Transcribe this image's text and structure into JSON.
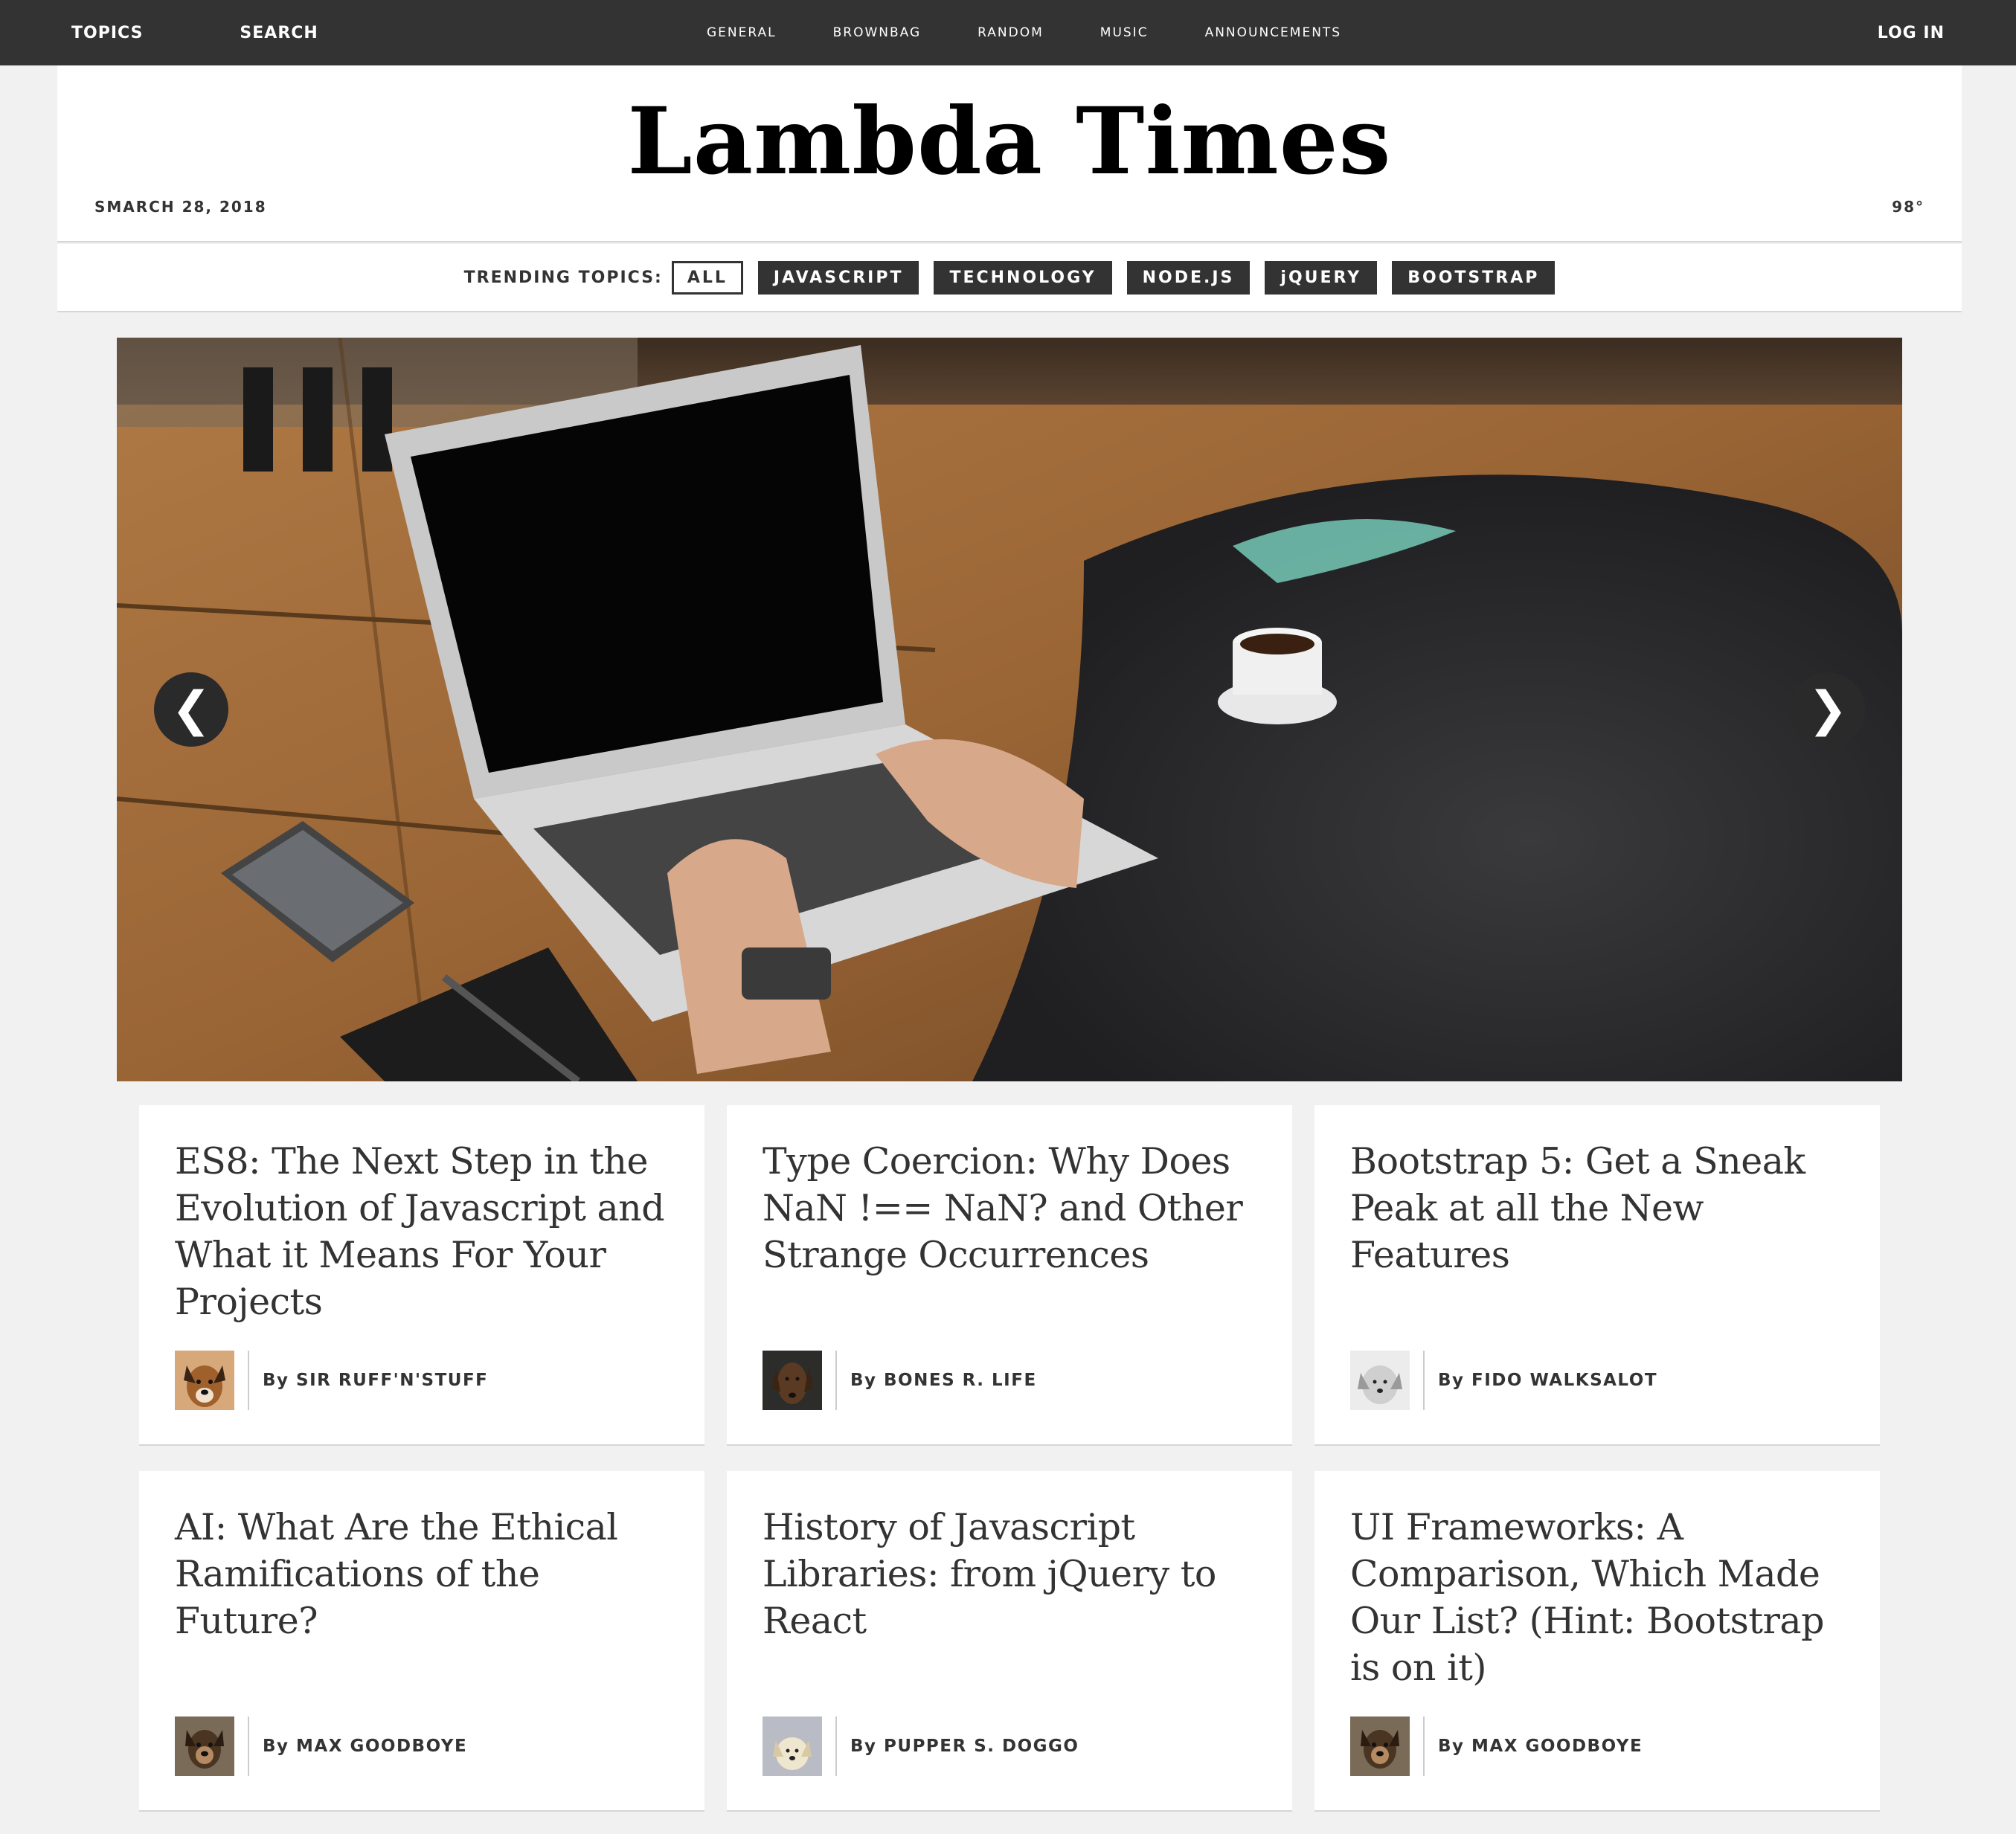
{
  "topbar": {
    "left_links": [
      "TOPICS",
      "SEARCH"
    ],
    "center_links": [
      "GENERAL",
      "BROWNBAG",
      "RANDOM",
      "MUSIC",
      "ANNOUNCEMENTS"
    ],
    "login": "LOG IN"
  },
  "header": {
    "title": "Lambda Times",
    "date": "SMARCH 28, 2018",
    "temperature": "98°"
  },
  "trending": {
    "label": "TRENDING TOPICS:",
    "tabs": [
      "ALL",
      "JAVASCRIPT",
      "TECHNOLOGY",
      "NODE.JS",
      "jQUERY",
      "BOOTSTRAP"
    ],
    "active_tab": "ALL"
  },
  "carousel": {
    "prev_arrow": "❮",
    "next_arrow": "❯"
  },
  "cards": [
    {
      "headline": "ES8: The Next Step in the Evolution of Javascript and What it Means For Your Projects",
      "byline": "By SIR RUFF'N'STUFF"
    },
    {
      "headline": "Type Coercion: Why Does NaN !== NaN? and Other Strange Occurrences",
      "byline": "By BONES R. LIFE"
    },
    {
      "headline": "Bootstrap 5: Get a Sneak Peak at all the New Features",
      "byline": "By FIDO WALKSALOT"
    },
    {
      "headline": "AI: What Are the Ethical Ramifications of the Future?",
      "byline": "By MAX GOODBOYE"
    },
    {
      "headline": "History of Javascript Libraries: from jQuery to React",
      "byline": "By PUPPER S. DOGGO"
    },
    {
      "headline": "UI Frameworks: A Comparison, Which Made Our List? (Hint: Bootstrap is on it)",
      "byline": "By MAX GOODBOYE"
    }
  ],
  "colors": {
    "topbar_bg": "#333333",
    "page_bg": "#f1f1f1",
    "card_bg": "#ffffff",
    "tab_bg": "#333333"
  }
}
